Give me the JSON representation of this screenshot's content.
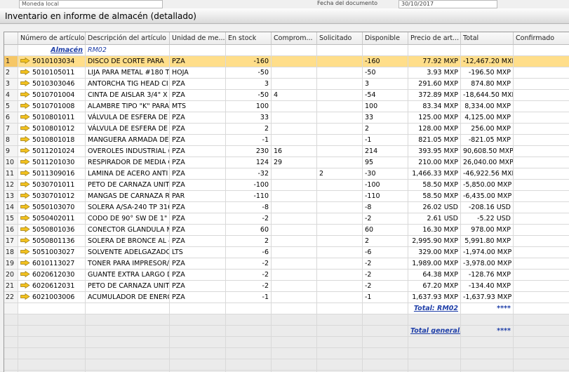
{
  "topbar": {
    "currency_value": "Moneda local",
    "doc_date_label": "Fecha del documento",
    "doc_date_value": "30/10/2017"
  },
  "window": {
    "title": "Inventario en informe de almacén (detallado)"
  },
  "table": {
    "columns": [
      "Número de artículo",
      "Descripción del artículo",
      "Unidad de me...",
      "En stock",
      "Comprom...",
      "Solicitado",
      "Disponible",
      "Precio de art...",
      "Total",
      "Confirmado"
    ],
    "warehouse": {
      "label": "Almacén",
      "code": "RM02"
    },
    "rows": [
      {
        "num": "1",
        "item": "5010103034",
        "desc": "DISCO DE CORTE PARA",
        "unit": "PZA",
        "stock": "-160",
        "comm": "",
        "ord": "",
        "avail": "-160",
        "price": "77.92 MXP",
        "total": "-12,467.20 MXP",
        "conf": ""
      },
      {
        "num": "2",
        "item": "5010105011",
        "desc": "LIJA PARA METAL #180 T",
        "unit": "HOJA",
        "stock": "-50",
        "comm": "",
        "ord": "",
        "avail": "-50",
        "price": "3.93 MXP",
        "total": "-196.50 MXP",
        "conf": ""
      },
      {
        "num": "3",
        "item": "5010303046",
        "desc": "ANTORCHA TIG HEAD CI",
        "unit": "PZA",
        "stock": "3",
        "comm": "",
        "ord": "",
        "avail": "3",
        "price": "291.60 MXP",
        "total": "874.80 MXP",
        "conf": ""
      },
      {
        "num": "4",
        "item": "5010701004",
        "desc": "CINTA DE AISLAR 3/4\" X",
        "unit": "PZA",
        "stock": "-50",
        "comm": "4",
        "ord": "",
        "avail": "-54",
        "price": "372.89 MXP",
        "total": "-18,644.50 MXP",
        "conf": ""
      },
      {
        "num": "5",
        "item": "5010701008",
        "desc": "ALAMBRE TIPO \"K\" PARA",
        "unit": "MTS",
        "stock": "100",
        "comm": "",
        "ord": "",
        "avail": "100",
        "price": "83.34 MXP",
        "total": "8,334.00 MXP",
        "conf": ""
      },
      {
        "num": "6",
        "item": "5010801011",
        "desc": "VÁLVULA DE ESFERA DE",
        "unit": "PZA",
        "stock": "33",
        "comm": "",
        "ord": "",
        "avail": "33",
        "price": "125.00 MXP",
        "total": "4,125.00 MXP",
        "conf": ""
      },
      {
        "num": "7",
        "item": "5010801012",
        "desc": "VÁLVULA DE ESFERA DE",
        "unit": "PZA",
        "stock": "2",
        "comm": "",
        "ord": "",
        "avail": "2",
        "price": "128.00 MXP",
        "total": "256.00 MXP",
        "conf": ""
      },
      {
        "num": "8",
        "item": "5010801018",
        "desc": "MANGUERA ARMADA DE",
        "unit": "PZA",
        "stock": "-1",
        "comm": "",
        "ord": "",
        "avail": "-1",
        "price": "821.05 MXP",
        "total": "-821.05 MXP",
        "conf": ""
      },
      {
        "num": "9",
        "item": "5011201024",
        "desc": "OVEROLES INDUSTRIAL (",
        "unit": "PZA",
        "stock": "230",
        "comm": "16",
        "ord": "",
        "avail": "214",
        "price": "393.95 MXP",
        "total": "90,608.50 MXP",
        "conf": ""
      },
      {
        "num": "10",
        "item": "5011201030",
        "desc": "RESPIRADOR DE MEDIA C",
        "unit": "PZA",
        "stock": "124",
        "comm": "29",
        "ord": "",
        "avail": "95",
        "price": "210.00 MXP",
        "total": "26,040.00 MXP",
        "conf": ""
      },
      {
        "num": "11",
        "item": "5011309016",
        "desc": "LAMINA DE ACERO ANTI",
        "unit": "PZA",
        "stock": "-32",
        "comm": "",
        "ord": "2",
        "avail": "-30",
        "price": "1,466.33 MXP",
        "total": "-46,922.56 MXP",
        "conf": ""
      },
      {
        "num": "12",
        "item": "5030701011",
        "desc": "PETO DE CARNAZA UNIT",
        "unit": "PZA",
        "stock": "-100",
        "comm": "",
        "ord": "",
        "avail": "-100",
        "price": "58.50 MXP",
        "total": "-5,850.00 MXP",
        "conf": ""
      },
      {
        "num": "13",
        "item": "5030701012",
        "desc": "MANGAS DE CARNAZA R",
        "unit": "PAR",
        "stock": "-110",
        "comm": "",
        "ord": "",
        "avail": "-110",
        "price": "58.50 MXP",
        "total": "-6,435.00 MXP",
        "conf": ""
      },
      {
        "num": "14",
        "item": "5050103070",
        "desc": "SOLERA A/SA-240 TP 316",
        "unit": "PZA",
        "stock": "-8",
        "comm": "",
        "ord": "",
        "avail": "-8",
        "price": "26.02 USD",
        "total": "-208.16 USD",
        "conf": ""
      },
      {
        "num": "15",
        "item": "5050402011",
        "desc": "CODO DE 90° SW DE 1\"",
        "unit": "PZA",
        "stock": "-2",
        "comm": "",
        "ord": "",
        "avail": "-2",
        "price": "2.61 USD",
        "total": "-5.22 USD",
        "conf": ""
      },
      {
        "num": "16",
        "item": "5050801036",
        "desc": "CONECTOR GLANDULA M",
        "unit": "PZA",
        "stock": "60",
        "comm": "",
        "ord": "",
        "avail": "60",
        "price": "16.30 MXP",
        "total": "978.00 MXP",
        "conf": ""
      },
      {
        "num": "17",
        "item": "5050801136",
        "desc": "SOLERA DE BRONCE AL 4",
        "unit": "PZA",
        "stock": "2",
        "comm": "",
        "ord": "",
        "avail": "2",
        "price": "2,995.90 MXP",
        "total": "5,991.80 MXP",
        "conf": ""
      },
      {
        "num": "18",
        "item": "5051003027",
        "desc": "SOLVENTE ADELGAZADO",
        "unit": "LTS",
        "stock": "-6",
        "comm": "",
        "ord": "",
        "avail": "-6",
        "price": "329.00 MXP",
        "total": "-1,974.00 MXP",
        "conf": ""
      },
      {
        "num": "19",
        "item": "6010113027",
        "desc": "TONER PARA IMPRESOR/",
        "unit": "PZA",
        "stock": "-2",
        "comm": "",
        "ord": "",
        "avail": "-2",
        "price": "1,989.00 MXP",
        "total": "-3,978.00 MXP",
        "conf": ""
      },
      {
        "num": "20",
        "item": "6020612030",
        "desc": "GUANTE EXTRA LARGO D",
        "unit": "PZA",
        "stock": "-2",
        "comm": "",
        "ord": "",
        "avail": "-2",
        "price": "64.38 MXP",
        "total": "-128.76 MXP",
        "conf": ""
      },
      {
        "num": "21",
        "item": "6020612031",
        "desc": "PETO DE CARNAZA UNIT",
        "unit": "PZA",
        "stock": "-2",
        "comm": "",
        "ord": "",
        "avail": "-2",
        "price": "67.20 MXP",
        "total": "-134.40 MXP",
        "conf": ""
      },
      {
        "num": "22",
        "item": "6021003006",
        "desc": "ACUMULADOR DE ENERG",
        "unit": "PZA",
        "stock": "-1",
        "comm": "",
        "ord": "",
        "avail": "-1",
        "price": "1,637.93 MXP",
        "total": "-1,637.93 MXP",
        "conf": ""
      }
    ],
    "subtotal": {
      "label": "Total: RM02",
      "value": "****"
    },
    "grandtotal": {
      "label": "Total general:",
      "value": "****"
    }
  },
  "colors": {
    "selected_row": "#ffde8a",
    "link_blue": "#1f3fa8",
    "arrow_fill": "#f3c21f"
  },
  "icons": {
    "row_link": "link-arrow-icon"
  }
}
